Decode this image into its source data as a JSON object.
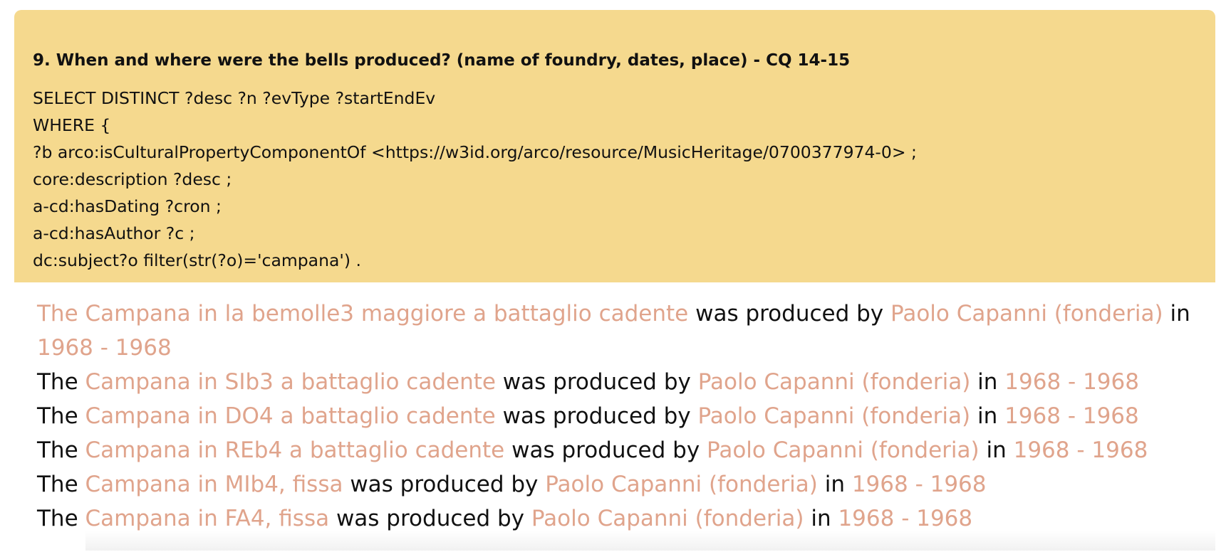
{
  "query": {
    "title": "9. When and where were the bells produced? (name of foundry, dates, place) - CQ 14-15",
    "lines": [
      "SELECT DISTINCT ?desc ?n ?evType ?startEndEv",
      "WHERE {",
      "?b arco:isCulturalPropertyComponentOf <https://w3id.org/arco/resource/MusicHeritage/0700377974-0> ;",
      "core:description ?desc ;",
      "a-cd:hasDating ?cron ;",
      "a-cd:hasAuthor ?c ;",
      "dc:subject?o filter(str(?o)='campana') ."
    ]
  },
  "results": [
    {
      "prefix": "",
      "bell": "The Campana in la bemolle3 maggiore a battaglio cadente",
      "mid": " was produced by ",
      "foundry": "Paolo Capanni (fonderia)",
      "in": " in ",
      "dates": "1968 - 1968"
    },
    {
      "prefix": "The ",
      "bell": "Campana in SIb3 a battaglio cadente",
      "mid": " was produced by ",
      "foundry": "Paolo Capanni (fonderia)",
      "in": " in ",
      "dates": "1968 - 1968"
    },
    {
      "prefix": "The ",
      "bell": "Campana in DO4 a battaglio cadente",
      "mid": " was produced by ",
      "foundry": "Paolo Capanni (fonderia)",
      "in": " in ",
      "dates": "1968 - 1968"
    },
    {
      "prefix": "The ",
      "bell": "Campana in REb4 a battaglio cadente",
      "mid": " was produced by ",
      "foundry": "Paolo Capanni (fonderia)",
      "in": " in ",
      "dates": "1968 - 1968"
    },
    {
      "prefix": "The ",
      "bell": "Campana in MIb4, fissa",
      "mid": " was produced by ",
      "foundry": "Paolo Capanni (fonderia)",
      "in": " in ",
      "dates": "1968 - 1968"
    },
    {
      "prefix": "The ",
      "bell": "Campana in FA4, fissa",
      "mid": " was produced by ",
      "foundry": "Paolo Capanni (fonderia)",
      "in": " in ",
      "dates": "1968 - 1968"
    }
  ],
  "colors": {
    "query_background": "#f5d98e",
    "link": "#e0a48c",
    "text": "#111111"
  }
}
